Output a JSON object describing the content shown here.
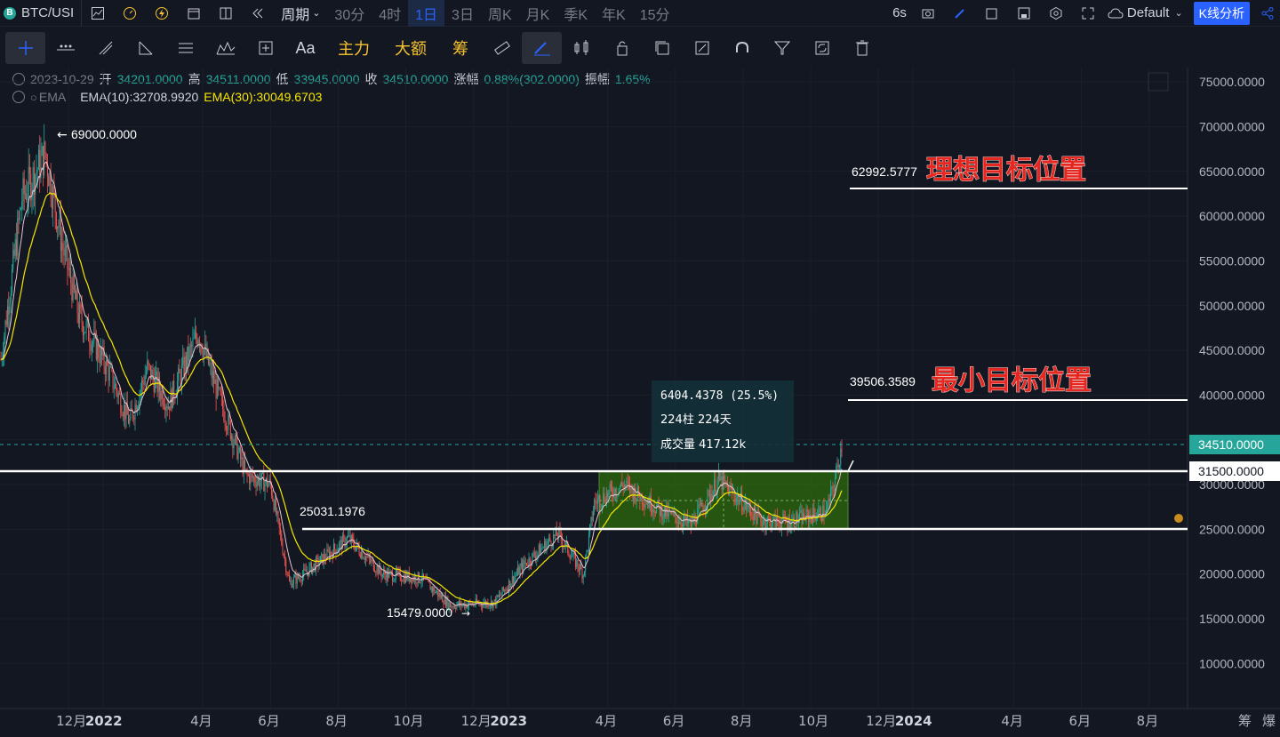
{
  "toolbar": {
    "symbol": "BTC/USI",
    "symbol_logo": "B",
    "period_label": "周期",
    "timeframes": [
      "30分",
      "4时",
      "1日",
      "3日",
      "周K",
      "月K",
      "季K",
      "年K",
      "15分"
    ],
    "active_timeframe": "1日",
    "refresh_interval": "6s",
    "theme": "Default",
    "kline_button": "K线分析"
  },
  "drawing_tools": {
    "font_tool": "Aa",
    "main_force": "主力",
    "large_amount": "大额",
    "chips": "筹"
  },
  "legend": {
    "date": "2023-10-29",
    "open_label": "开",
    "open": "34201.0000",
    "high_label": "高",
    "high": "34511.0000",
    "low_label": "低",
    "low": "33945.0000",
    "close_label": "收",
    "close": "34510.0000",
    "change_label": "涨幅",
    "change": "0.88%(302.0000)",
    "amplitude_label": "振幅",
    "amplitude": "1.65%",
    "indicator": "EMA",
    "ema10": "EMA(10):32708.9920",
    "ema30": "EMA(30):30049.6703"
  },
  "annotations": {
    "ideal_target_price": "62992.5777",
    "ideal_target_label": "理想目标位置",
    "min_target_price": "39506.3589",
    "min_target_label": "最小目标位置",
    "range_top_price": "31500.0000",
    "range_bottom_price": "25031.1976",
    "ath": "69000.0000",
    "low": "15479.0000",
    "measure_change": "6404.4378 (25.5%)",
    "measure_bars": "224柱 224天",
    "measure_volume": "成交量 417.12k",
    "last_price": "34510.0000"
  },
  "colors": {
    "background": "#131722",
    "up": "#26a69a",
    "down": "#ef5350",
    "ema10": "#d1d4dc",
    "ema30": "#f7e600",
    "label_red": "#e5271f",
    "range_box": "#2e6b0e",
    "accent": "#2962ff"
  },
  "chart_data": {
    "type": "candlestick",
    "ylim": [
      5000,
      78000
    ],
    "y_ticks": [
      10000,
      15000,
      20000,
      25000,
      30000,
      35000,
      40000,
      45000,
      50000,
      55000,
      60000,
      65000,
      70000,
      75000
    ],
    "x_ticks": [
      "12月",
      "2022",
      "4月",
      "6月",
      "8月",
      "10月",
      "12月",
      "2023",
      "4月",
      "6月",
      "8月",
      "10月",
      "12月",
      "2024",
      "4月",
      "6月",
      "8月"
    ],
    "price_path": [
      [
        "2021-10-01",
        44000
      ],
      [
        "2021-10-20",
        62000
      ],
      [
        "2021-11-10",
        67000
      ],
      [
        "2021-11-25",
        57000
      ],
      [
        "2021-12-10",
        49000
      ],
      [
        "2022-01-05",
        43000
      ],
      [
        "2022-01-25",
        37000
      ],
      [
        "2022-02-10",
        43000
      ],
      [
        "2022-03-01",
        39000
      ],
      [
        "2022-03-28",
        47000
      ],
      [
        "2022-04-15",
        40000
      ],
      [
        "2022-05-10",
        31000
      ],
      [
        "2022-06-01",
        30000
      ],
      [
        "2022-06-18",
        19000
      ],
      [
        "2022-07-01",
        20000
      ],
      [
        "2022-08-10",
        24000
      ],
      [
        "2022-09-10",
        20000
      ],
      [
        "2022-10-15",
        19500
      ],
      [
        "2022-11-10",
        16500
      ],
      [
        "2022-12-20",
        16800
      ],
      [
        "2023-01-15",
        21000
      ],
      [
        "2023-02-15",
        24500
      ],
      [
        "2023-03-10",
        20000
      ],
      [
        "2023-03-20",
        28000
      ],
      [
        "2023-04-15",
        30000
      ],
      [
        "2023-05-20",
        27000
      ],
      [
        "2023-06-15",
        25500
      ],
      [
        "2023-07-10",
        30500
      ],
      [
        "2023-08-17",
        26000
      ],
      [
        "2023-09-10",
        25800
      ],
      [
        "2023-10-15",
        27000
      ],
      [
        "2023-10-22",
        30000
      ],
      [
        "2023-10-29",
        34510
      ]
    ]
  }
}
